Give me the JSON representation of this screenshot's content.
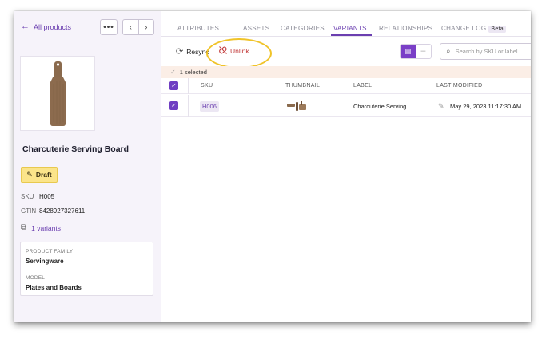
{
  "sidebar": {
    "back_label": "All products",
    "more_label": "•••",
    "prev_label": "‹",
    "next_label": "›",
    "product_title": "Charcuterie Serving Board",
    "status_label": "Draft",
    "sku_key": "SKU",
    "sku_value": "H005",
    "gtin_key": "GTIN",
    "gtin_value": "8428927327611",
    "variants_label": "1 variants",
    "family_label": "PRODUCT FAMILY",
    "family_value": "Servingware",
    "model_label": "MODEL",
    "model_value": "Plates and Boards"
  },
  "tabs": [
    {
      "label": "ATTRIBUTES"
    },
    {
      "label": "ASSETS"
    },
    {
      "label": "CATEGORIES"
    },
    {
      "label": "VARIANTS"
    },
    {
      "label": "RELATIONSHIPS"
    },
    {
      "label": "CHANGE LOG"
    }
  ],
  "tab_active": "VARIANTS",
  "beta_label": "Beta",
  "toolbar": {
    "resync_label": "Resync",
    "unlink_label": "Unlink"
  },
  "search": {
    "placeholder": "Search by SKU or label"
  },
  "selection": {
    "text": "1 selected"
  },
  "table": {
    "headers": {
      "sku": "SKU",
      "thumbnail": "THUMBNAIL",
      "label": "LABEL",
      "modified": "LAST MODIFIED"
    },
    "rows": [
      {
        "sku": "H006",
        "label": "Charcuterie Serving ...",
        "modified": "May 29, 2023 11:17:30 AM"
      }
    ]
  },
  "colors": {
    "accent": "#6b3fb0",
    "danger": "#c23b3b",
    "draft": "#fbe48a",
    "highlight": "#f0c328"
  },
  "icons": {
    "back": "arrow-left-icon",
    "resync": "refresh-icon",
    "unlink": "link-off-icon",
    "search": "search-icon",
    "variants": "stack-icon",
    "edit": "pencil-icon"
  }
}
